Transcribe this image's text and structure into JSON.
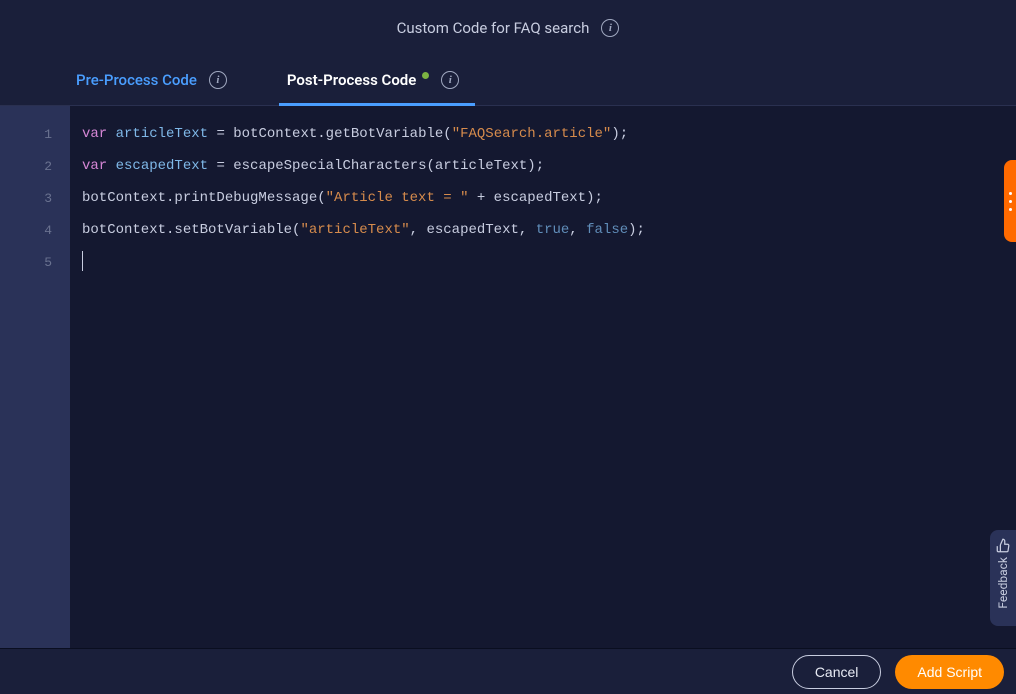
{
  "header": {
    "title": "Custom Code for FAQ search"
  },
  "tabs": {
    "pre": "Pre-Process Code",
    "post": "Post-Process Code"
  },
  "code": {
    "lines": [
      "1",
      "2",
      "3",
      "4",
      "5"
    ],
    "l1": {
      "kw": "var",
      "ident": "articleText",
      "rest1": " = botContext.getBotVariable(",
      "str": "\"FAQSearch.article\"",
      "rest2": ");"
    },
    "l2": {
      "kw": "var",
      "ident": "escapedText",
      "rest1": " = escapeSpecialCharacters(articleText);"
    },
    "l3": {
      "rest1": "botContext.printDebugMessage(",
      "str": "\"Article text = \"",
      "rest2": " + escapedText);"
    },
    "l4": {
      "rest1": "botContext.setBotVariable(",
      "str": "\"articleText\"",
      "rest2": ", escapedText, ",
      "bool1": "true",
      "rest3": ", ",
      "bool2": "false",
      "rest4": ");"
    }
  },
  "footer": {
    "cancel": "Cancel",
    "add": "Add Script"
  },
  "feedback": {
    "label": "Feedback"
  }
}
